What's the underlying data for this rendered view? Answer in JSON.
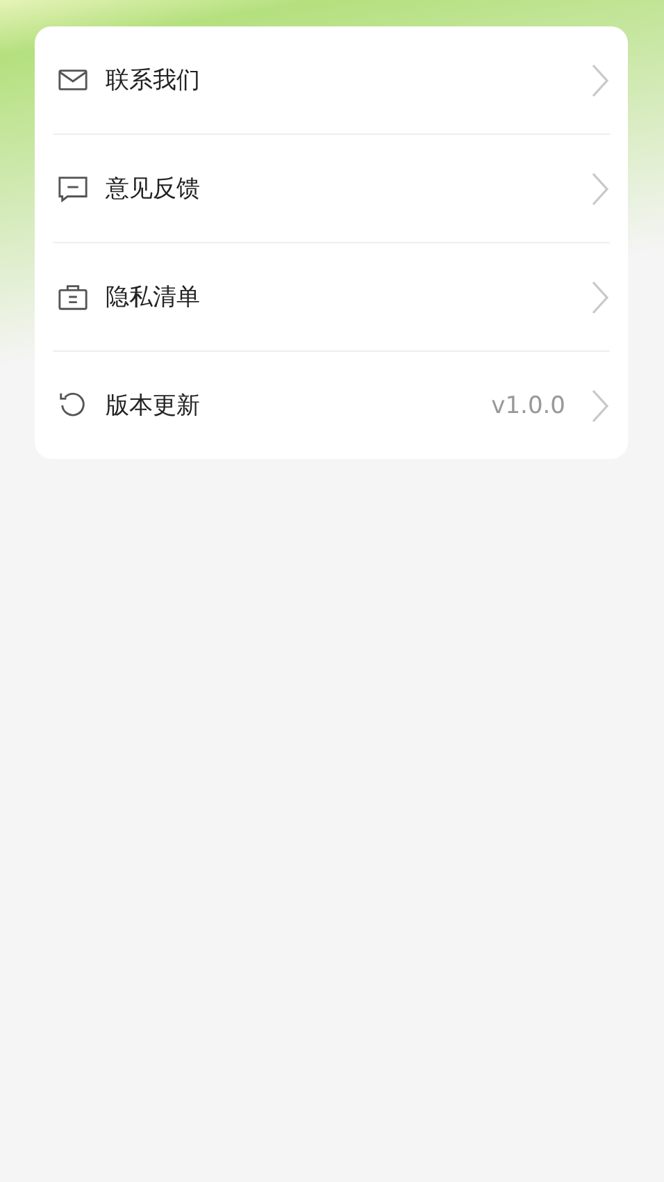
{
  "menu": {
    "items": [
      {
        "label": "联系我们"
      },
      {
        "label": "意见反馈"
      },
      {
        "label": "隐私清单"
      },
      {
        "label": "版本更新",
        "value": "v1.0.0"
      }
    ]
  }
}
